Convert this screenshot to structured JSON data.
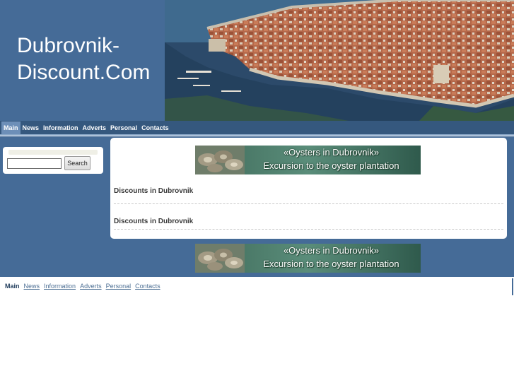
{
  "header": {
    "title_line1": "Dubrovnik-",
    "title_line2": "Discount.Com",
    "background_color": "#456b97"
  },
  "nav": {
    "items": [
      {
        "label": "Main",
        "active": true
      },
      {
        "label": "News",
        "active": false
      },
      {
        "label": "Information",
        "active": false
      },
      {
        "label": "Adverts",
        "active": false
      },
      {
        "label": "Personal",
        "active": false
      },
      {
        "label": "Contacts",
        "active": false
      }
    ]
  },
  "search": {
    "value": "",
    "button_label": "Search"
  },
  "banner": {
    "line1": "«Oysters in Dubrovnik»",
    "line2": "Excursion to the oyster plantation"
  },
  "content": {
    "sections": [
      {
        "heading": "Discounts in Dubrovnik"
      },
      {
        "heading": "Discounts in Dubrovnik"
      }
    ]
  },
  "footer_nav": {
    "items": [
      {
        "label": "Main",
        "active": true
      },
      {
        "label": "News",
        "active": false
      },
      {
        "label": "Information",
        "active": false
      },
      {
        "label": "Adverts",
        "active": false
      },
      {
        "label": "Personal",
        "active": false
      },
      {
        "label": "Contacts",
        "active": false
      }
    ]
  },
  "colors": {
    "brand_blue": "#456b97",
    "nav_blue": "#35587e",
    "link_color": "#4d6f94"
  }
}
